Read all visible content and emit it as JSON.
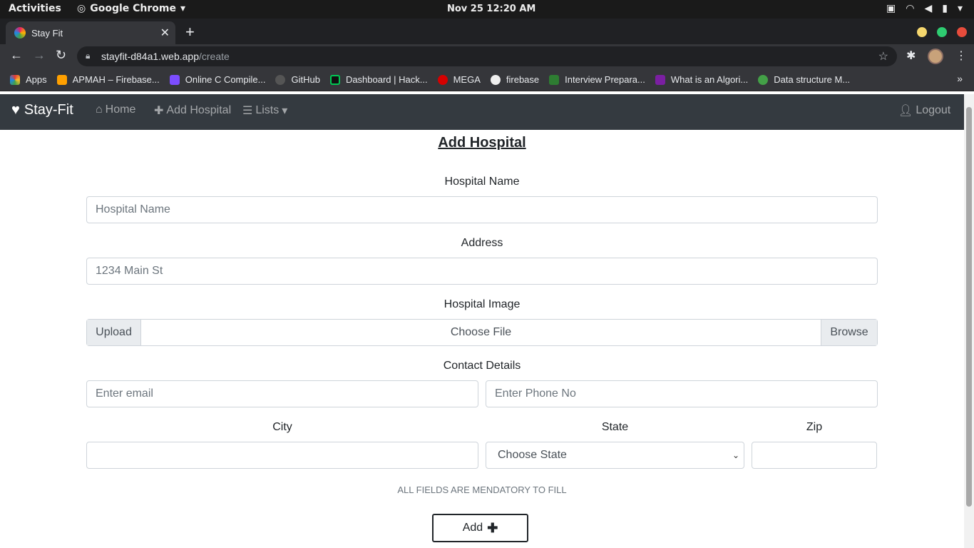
{
  "os": {
    "activities": "Activities",
    "app_name": "Google Chrome",
    "clock": "Nov 25  12:20 AM"
  },
  "browser": {
    "tab_title": "Stay Fit",
    "url_domain": "stayfit-d84a1.web.app",
    "url_path": "/create",
    "bookmarks": [
      {
        "label": "Apps",
        "color": "#e53935"
      },
      {
        "label": "APMAH – Firebase...",
        "color": "#ffa000"
      },
      {
        "label": "Online C Compile...",
        "color": "#7c4dff"
      },
      {
        "label": "GitHub",
        "color": "#555555"
      },
      {
        "label": "Dashboard | Hack...",
        "color": "#00c853"
      },
      {
        "label": "MEGA",
        "color": "#d50000"
      },
      {
        "label": "firebase",
        "color": "#eeeeee"
      },
      {
        "label": "Interview Prepara...",
        "color": "#2e7d32"
      },
      {
        "label": "What is an Algori...",
        "color": "#7b1fa2"
      },
      {
        "label": "Data structure M...",
        "color": "#43a047"
      }
    ]
  },
  "navbar": {
    "brand": "Stay-Fit",
    "home": "Home",
    "add_hospital": "Add Hospital",
    "lists": "Lists",
    "logout": "Logout"
  },
  "form": {
    "title": "Add Hospital",
    "hospital_name_label": "Hospital Name",
    "hospital_name_placeholder": "Hospital Name",
    "address_label": "Address",
    "address_placeholder": "1234 Main St",
    "image_label": "Hospital Image",
    "upload": "Upload",
    "choose_file": "Choose File",
    "browse": "Browse",
    "contact_label": "Contact Details",
    "email_placeholder": "Enter email",
    "phone_placeholder": "Enter Phone No",
    "city_label": "City",
    "state_label": "State",
    "zip_label": "Zip",
    "state_selected": "Choose State",
    "note": "ALL FIELDS ARE MENDATORY TO FILL",
    "add_button": "Add"
  }
}
